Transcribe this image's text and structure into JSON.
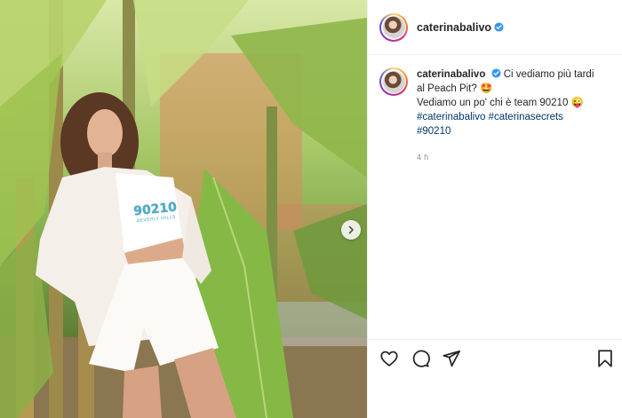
{
  "post": {
    "username": "caterinabalivo",
    "verified": true,
    "caption": {
      "username": "caterinabalivo",
      "line1": "Ci vediamo più tardi al Peach Pit? 🤩",
      "line2": "Vediamo un po' chi è team 90210 😜",
      "hashtags": [
        "#caterinabalivo",
        "#caterinasecrets",
        "#90210"
      ]
    },
    "timestamp": "4 h"
  },
  "photo": {
    "shirt_print": "90210",
    "shirt_subtext": "BEVERLY HILLS"
  },
  "icons": {
    "like": "heart-icon",
    "comment": "comment-icon",
    "share": "share-icon",
    "save": "bookmark-icon",
    "next": "chevron-right-icon",
    "verified": "verified-badge-icon"
  },
  "colors": {
    "hashtag": "#00376b",
    "verified": "#3897f0",
    "muted": "#8e8e8e"
  }
}
